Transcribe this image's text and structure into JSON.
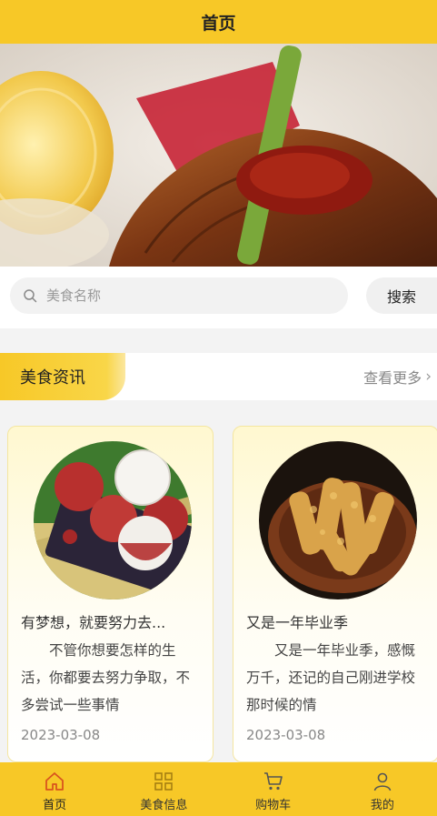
{
  "header": {
    "title": "首页"
  },
  "banner": {
    "alt": "banner-food-image"
  },
  "search": {
    "placeholder": "美食名称",
    "button_label": "搜索"
  },
  "section": {
    "title": "美食资讯",
    "more_label": "查看更多"
  },
  "cards": [
    {
      "title": "有梦想，就要努力去...",
      "description": "不管你想要怎样的生活，你都要去努力争取，不多尝试一些事情",
      "date": "2023-03-08",
      "image": "lychee-photo"
    },
    {
      "title": "又是一年毕业季",
      "description": "又是一年毕业季，感慨万千，还记的自己刚进学校那时候的情",
      "date": "2023-03-08",
      "image": "fried-food-photo"
    }
  ],
  "tabbar": {
    "items": [
      {
        "label": "首页",
        "icon": "home-icon",
        "active": true
      },
      {
        "label": "美食信息",
        "icon": "grid-icon",
        "active": false
      },
      {
        "label": "购物车",
        "icon": "cart-icon",
        "active": false
      },
      {
        "label": "我的",
        "icon": "user-icon",
        "active": false
      }
    ]
  },
  "colors": {
    "primary": "#f7c827",
    "background": "#f3f3f3"
  }
}
